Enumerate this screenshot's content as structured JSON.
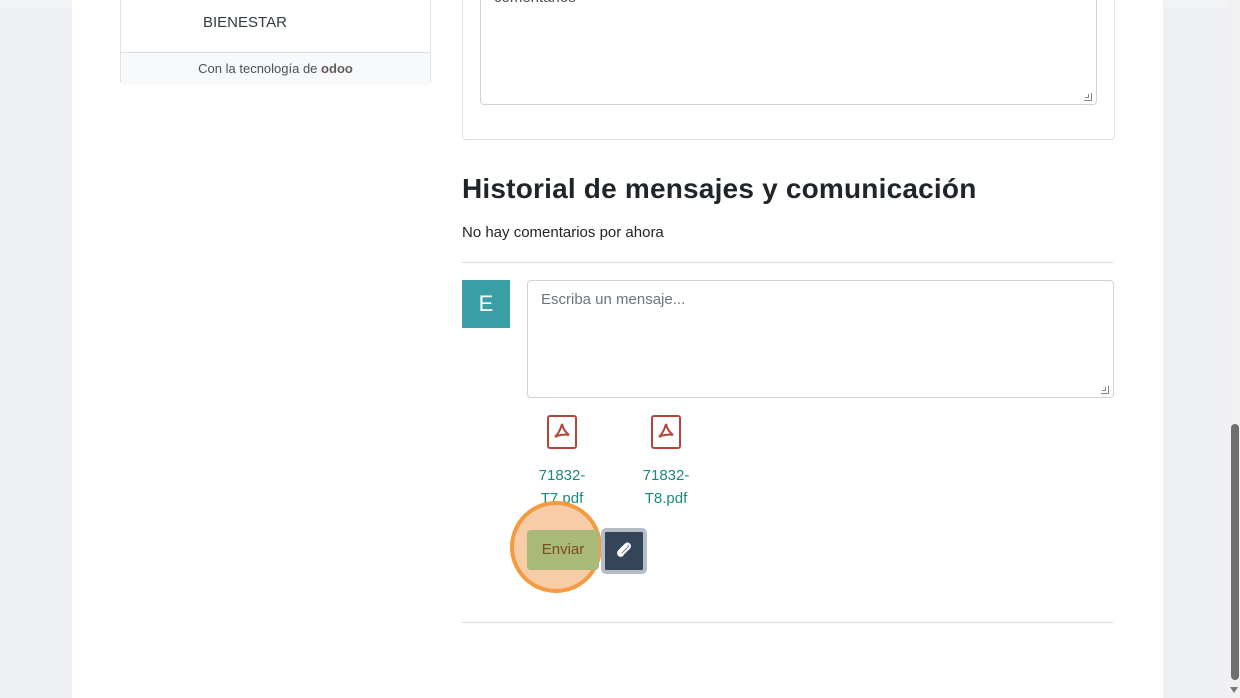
{
  "sidebar": {
    "item_label": "BIENESTAR",
    "powered_prefix": "Con la tecnología de",
    "logo_text": "odoo"
  },
  "comment_box": {
    "value": "comentarios"
  },
  "history": {
    "title": "Historial de mensajes y comunicación",
    "empty_text": "No hay comentarios por ahora"
  },
  "composer": {
    "avatar_initial": "E",
    "placeholder": "Escriba un mensaje...",
    "attachments": [
      {
        "line1": "71832-",
        "line2": "T7.pdf",
        "icon": "pdf-icon"
      },
      {
        "line1": "71832-",
        "line2": "T8.pdf",
        "icon": "pdf-icon"
      }
    ],
    "send_label": "Enviar",
    "attach_button_icon": "paperclip-icon"
  },
  "colors": {
    "avatar_bg": "#3a9ea5",
    "send_button": "#a9b978",
    "highlight": "#f59a3e",
    "attach_link": "#1a8a7a",
    "pdf_red": "#b5453a"
  }
}
